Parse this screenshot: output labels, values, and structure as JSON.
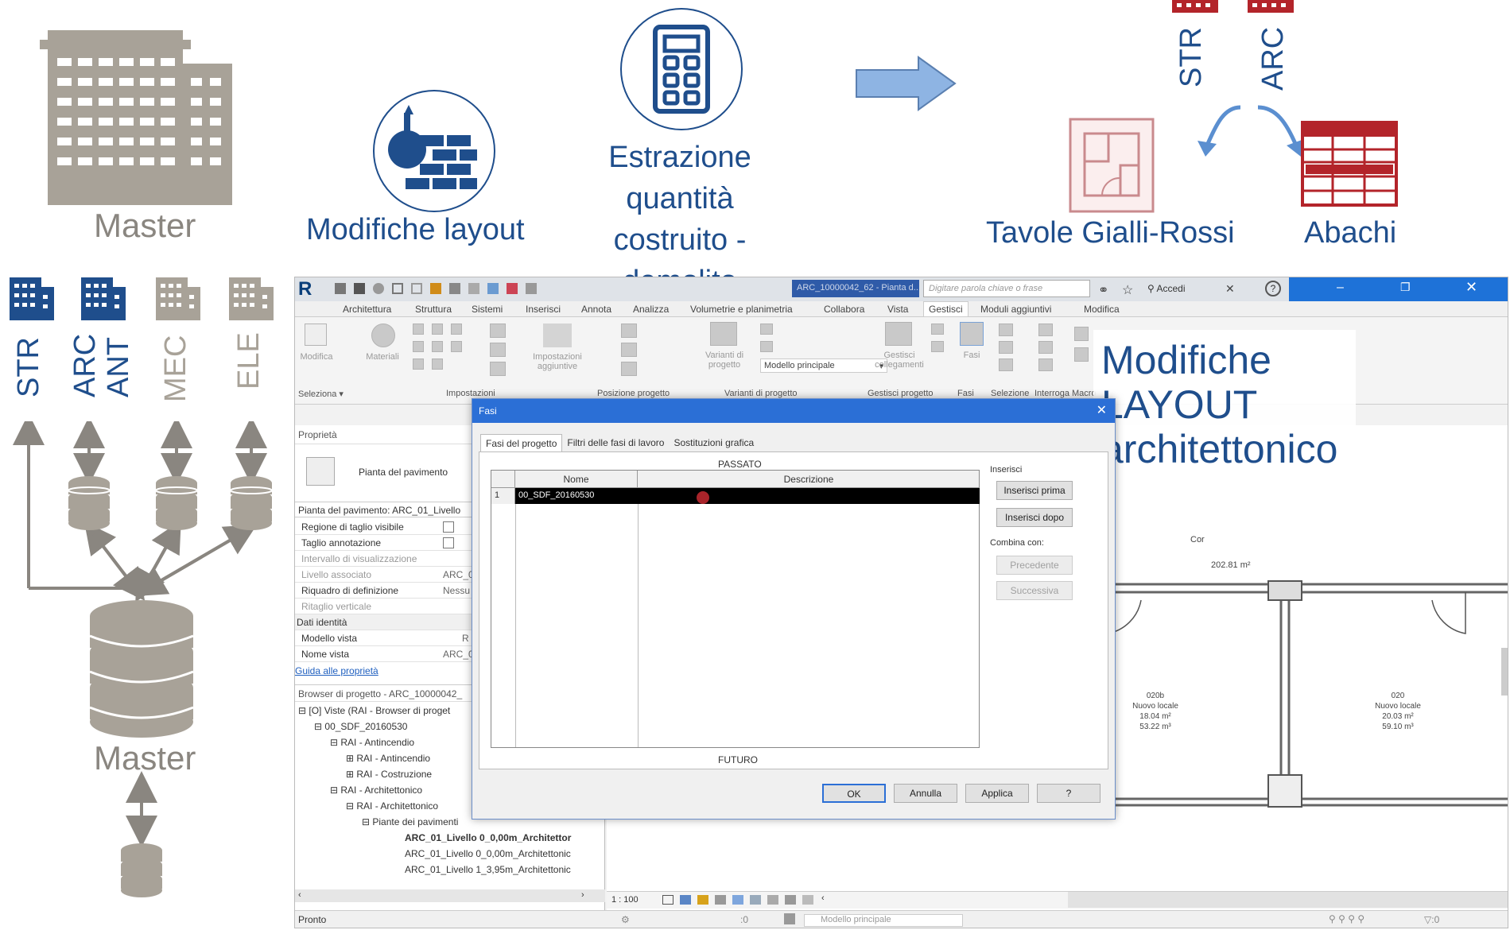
{
  "header": {
    "master_top": "Master",
    "modifiche_layout": "Modifiche layout",
    "estrazione_line1": "Estrazione quantità",
    "estrazione_line2": "costruito - demolito",
    "str_top": "STR",
    "arc_top": "ARC",
    "tavole": "Tavole Gialli-Rossi",
    "abachi": "Abachi"
  },
  "left_diagram": {
    "disciplines": [
      "STR",
      "ARC",
      "ANT",
      "MEC",
      "ELE"
    ],
    "master_bottom": "Master"
  },
  "overlay": {
    "line1": "Modifiche",
    "line2": "LAYOUT",
    "line3": "architettonico"
  },
  "revit": {
    "title_file": "ARC_10000042_62 - Pianta d...",
    "search_placeholder": "Digitare parola chiave o frase",
    "accedi": "Accedi",
    "tabs": [
      "Architettura",
      "Struttura",
      "Sistemi",
      "Inserisci",
      "Annota",
      "Analizza",
      "Volumetrie e planimetria",
      "Collabora",
      "Vista",
      "Gestisci",
      "Moduli aggiuntivi",
      "Modifica"
    ],
    "ribbon": {
      "modifica": "Modifica",
      "materiali": "Materiali",
      "impostazioni": "Impostazioni aggiuntive",
      "varianti": "Varianti di progetto",
      "modello_principale": "Modello principale",
      "gestisci_collegamenti": "Gestisci collegamenti",
      "fasi": "Fasi",
      "panels": [
        "Seleziona",
        "Impostazioni",
        "Posizione progetto",
        "Varianti di progetto",
        "Gestisci progetto",
        "Fasi",
        "Selezione",
        "Interroga",
        "Macro"
      ]
    },
    "properties": {
      "title": "Proprietà",
      "type_name": "Pianta del pavimento",
      "instance_label": "Pianta del pavimento: ARC_01_Livello",
      "rows": [
        {
          "k": "Regione di taglio visibile",
          "v": ""
        },
        {
          "k": "Taglio annotazione",
          "v": ""
        },
        {
          "k": "Intervallo di visualizzazione",
          "v": ""
        },
        {
          "k": "Livello associato",
          "v": "ARC_0"
        },
        {
          "k": "Riquadro di definizione",
          "v": "Nessu"
        },
        {
          "k": "Ritaglio verticale",
          "v": ""
        },
        {
          "k": "Dati identità",
          "v": ""
        },
        {
          "k": "Modello vista",
          "v": "R"
        },
        {
          "k": "Nome vista",
          "v": "ARC_0"
        }
      ],
      "help_link": "Guida alle proprietà"
    },
    "browser": {
      "title": "Browser di progetto - ARC_10000042_",
      "items": [
        "Viste (RAI - Browser di proget",
        "00_SDF_20160530",
        "RAI - Antincendio",
        "RAI - Antincendio",
        "RAI - Costruzione",
        "RAI - Architettonico",
        "RAI - Architettonico",
        "Piante dei pavimenti",
        "ARC_01_Livello 0_0,00m_Architettor",
        "ARC_01_Livello 0_0,00m_Architettonic",
        "ARC_01_Livello 1_3,95m_Architettonic"
      ]
    },
    "plan": {
      "room_left_num": "020b",
      "room_left_name": "Nuovo locale",
      "room_left_area": "18.04 m²",
      "room_left_vol": "53.22 m³",
      "room_right_num": "020",
      "room_right_name": "Nuovo locale",
      "room_right_area": "20.03 m²",
      "room_right_vol": "59.10 m³",
      "corridor_area": "202.81 m²",
      "corridor_label": "Cor"
    },
    "view_bar": {
      "scale": "1 : 100"
    },
    "status": {
      "ready": "Pronto",
      "zero": ":0",
      "model": "Modello principale",
      "filter": ":0"
    }
  },
  "dialog": {
    "title": "Fasi",
    "tabs": [
      "Fasi del progetto",
      "Filtri delle fasi di lavoro",
      "Sostituzioni grafica"
    ],
    "passato": "PASSATO",
    "futuro": "FUTURO",
    "col_nome": "Nome",
    "col_descrizione": "Descrizione",
    "rows": [
      {
        "num": "1",
        "nome": "00_SDF_20160530",
        "descrizione": ""
      }
    ],
    "inserisci_label": "Inserisci",
    "inserisci_prima": "Inserisci prima",
    "inserisci_dopo": "Inserisci dopo",
    "combina_label": "Combina con:",
    "precedente": "Precedente",
    "successiva": "Successiva",
    "ok": "OK",
    "annulla": "Annulla",
    "applica": "Applica",
    "help": "?"
  },
  "colors": {
    "blue": "#1f4e8c",
    "gray": "#a8a298",
    "red": "#b3242a",
    "arrow": "#8eb4e3"
  }
}
